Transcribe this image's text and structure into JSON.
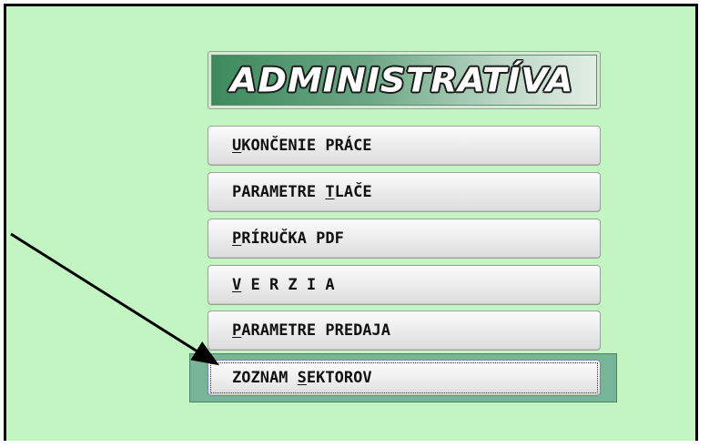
{
  "window": {
    "title": "ADMINISTRATÍVA"
  },
  "menu": {
    "items": [
      {
        "pre": "",
        "key": "U",
        "post": "KONČENIE PRÁCE"
      },
      {
        "pre": "PARAMETRE ",
        "key": "T",
        "post": "LAČE"
      },
      {
        "pre": "",
        "key": "P",
        "post": "RÍRUČKA PDF"
      },
      {
        "pre": "",
        "key": "V",
        "post": " E R Z I A"
      },
      {
        "pre": "",
        "key": "P",
        "post": "ARAMETRE PREDAJA"
      },
      {
        "pre": "ZOZNAM ",
        "key": "S",
        "post": "EKTOROV"
      }
    ],
    "selected_index": 5
  },
  "colors": {
    "background": "#c3f5c3",
    "selection": "#76b597",
    "title_gradient_start": "#3d8a5e"
  },
  "icons": {
    "pointer": "arrow-pointer-icon"
  }
}
